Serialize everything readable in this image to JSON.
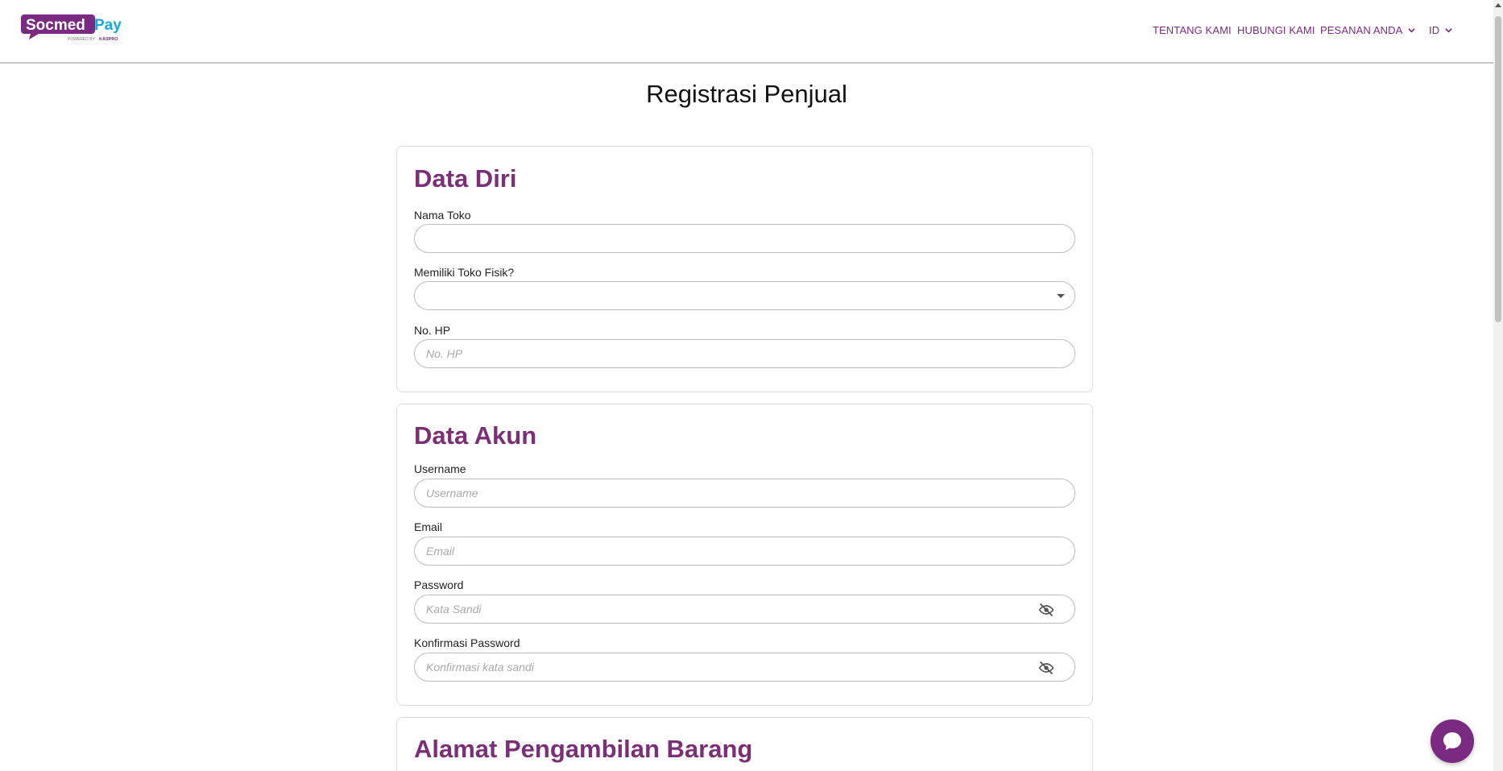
{
  "brand": {
    "name_part1": "Socmed",
    "name_part2": "Pay",
    "tagline": "POWERED BY",
    "partner": "KASPRO",
    "primary_color": "#7b2a82",
    "accent_color": "#1aa7e0"
  },
  "nav": {
    "about": "TENTANG KAMI",
    "contact": "HUBUNGI KAMI",
    "orders": "PESANAN ANDA",
    "language": "ID"
  },
  "page": {
    "title": "Registrasi Penjual"
  },
  "personal": {
    "title": "Data Diri",
    "store_name_label": "Nama Toko",
    "store_name_value": "",
    "physical_store_label": "Memiliki Toko Fisik?",
    "physical_store_value": "",
    "phone_label": "No. HP",
    "phone_placeholder": "No. HP"
  },
  "account": {
    "title": "Data Akun",
    "username_label": "Username",
    "username_placeholder": "Username",
    "email_label": "Email",
    "email_placeholder": "Email",
    "password_label": "Password",
    "password_placeholder": "Kata Sandi",
    "confirm_label": "Konfirmasi Password",
    "confirm_placeholder": "Konfirmasi kata sandi"
  },
  "pickup": {
    "title": "Alamat Pengambilan Barang"
  }
}
